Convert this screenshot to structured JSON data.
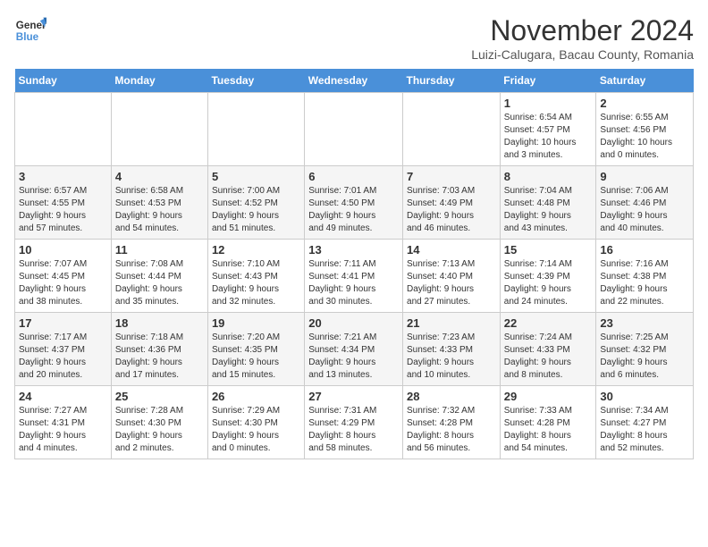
{
  "logo": {
    "line1": "General",
    "line2": "Blue"
  },
  "title": "November 2024",
  "subtitle": "Luizi-Calugara, Bacau County, Romania",
  "weekdays": [
    "Sunday",
    "Monday",
    "Tuesday",
    "Wednesday",
    "Thursday",
    "Friday",
    "Saturday"
  ],
  "weeks": [
    [
      {
        "day": "",
        "info": ""
      },
      {
        "day": "",
        "info": ""
      },
      {
        "day": "",
        "info": ""
      },
      {
        "day": "",
        "info": ""
      },
      {
        "day": "",
        "info": ""
      },
      {
        "day": "1",
        "info": "Sunrise: 6:54 AM\nSunset: 4:57 PM\nDaylight: 10 hours\nand 3 minutes."
      },
      {
        "day": "2",
        "info": "Sunrise: 6:55 AM\nSunset: 4:56 PM\nDaylight: 10 hours\nand 0 minutes."
      }
    ],
    [
      {
        "day": "3",
        "info": "Sunrise: 6:57 AM\nSunset: 4:55 PM\nDaylight: 9 hours\nand 57 minutes."
      },
      {
        "day": "4",
        "info": "Sunrise: 6:58 AM\nSunset: 4:53 PM\nDaylight: 9 hours\nand 54 minutes."
      },
      {
        "day": "5",
        "info": "Sunrise: 7:00 AM\nSunset: 4:52 PM\nDaylight: 9 hours\nand 51 minutes."
      },
      {
        "day": "6",
        "info": "Sunrise: 7:01 AM\nSunset: 4:50 PM\nDaylight: 9 hours\nand 49 minutes."
      },
      {
        "day": "7",
        "info": "Sunrise: 7:03 AM\nSunset: 4:49 PM\nDaylight: 9 hours\nand 46 minutes."
      },
      {
        "day": "8",
        "info": "Sunrise: 7:04 AM\nSunset: 4:48 PM\nDaylight: 9 hours\nand 43 minutes."
      },
      {
        "day": "9",
        "info": "Sunrise: 7:06 AM\nSunset: 4:46 PM\nDaylight: 9 hours\nand 40 minutes."
      }
    ],
    [
      {
        "day": "10",
        "info": "Sunrise: 7:07 AM\nSunset: 4:45 PM\nDaylight: 9 hours\nand 38 minutes."
      },
      {
        "day": "11",
        "info": "Sunrise: 7:08 AM\nSunset: 4:44 PM\nDaylight: 9 hours\nand 35 minutes."
      },
      {
        "day": "12",
        "info": "Sunrise: 7:10 AM\nSunset: 4:43 PM\nDaylight: 9 hours\nand 32 minutes."
      },
      {
        "day": "13",
        "info": "Sunrise: 7:11 AM\nSunset: 4:41 PM\nDaylight: 9 hours\nand 30 minutes."
      },
      {
        "day": "14",
        "info": "Sunrise: 7:13 AM\nSunset: 4:40 PM\nDaylight: 9 hours\nand 27 minutes."
      },
      {
        "day": "15",
        "info": "Sunrise: 7:14 AM\nSunset: 4:39 PM\nDaylight: 9 hours\nand 24 minutes."
      },
      {
        "day": "16",
        "info": "Sunrise: 7:16 AM\nSunset: 4:38 PM\nDaylight: 9 hours\nand 22 minutes."
      }
    ],
    [
      {
        "day": "17",
        "info": "Sunrise: 7:17 AM\nSunset: 4:37 PM\nDaylight: 9 hours\nand 20 minutes."
      },
      {
        "day": "18",
        "info": "Sunrise: 7:18 AM\nSunset: 4:36 PM\nDaylight: 9 hours\nand 17 minutes."
      },
      {
        "day": "19",
        "info": "Sunrise: 7:20 AM\nSunset: 4:35 PM\nDaylight: 9 hours\nand 15 minutes."
      },
      {
        "day": "20",
        "info": "Sunrise: 7:21 AM\nSunset: 4:34 PM\nDaylight: 9 hours\nand 13 minutes."
      },
      {
        "day": "21",
        "info": "Sunrise: 7:23 AM\nSunset: 4:33 PM\nDaylight: 9 hours\nand 10 minutes."
      },
      {
        "day": "22",
        "info": "Sunrise: 7:24 AM\nSunset: 4:33 PM\nDaylight: 9 hours\nand 8 minutes."
      },
      {
        "day": "23",
        "info": "Sunrise: 7:25 AM\nSunset: 4:32 PM\nDaylight: 9 hours\nand 6 minutes."
      }
    ],
    [
      {
        "day": "24",
        "info": "Sunrise: 7:27 AM\nSunset: 4:31 PM\nDaylight: 9 hours\nand 4 minutes."
      },
      {
        "day": "25",
        "info": "Sunrise: 7:28 AM\nSunset: 4:30 PM\nDaylight: 9 hours\nand 2 minutes."
      },
      {
        "day": "26",
        "info": "Sunrise: 7:29 AM\nSunset: 4:30 PM\nDaylight: 9 hours\nand 0 minutes."
      },
      {
        "day": "27",
        "info": "Sunrise: 7:31 AM\nSunset: 4:29 PM\nDaylight: 8 hours\nand 58 minutes."
      },
      {
        "day": "28",
        "info": "Sunrise: 7:32 AM\nSunset: 4:28 PM\nDaylight: 8 hours\nand 56 minutes."
      },
      {
        "day": "29",
        "info": "Sunrise: 7:33 AM\nSunset: 4:28 PM\nDaylight: 8 hours\nand 54 minutes."
      },
      {
        "day": "30",
        "info": "Sunrise: 7:34 AM\nSunset: 4:27 PM\nDaylight: 8 hours\nand 52 minutes."
      }
    ]
  ]
}
